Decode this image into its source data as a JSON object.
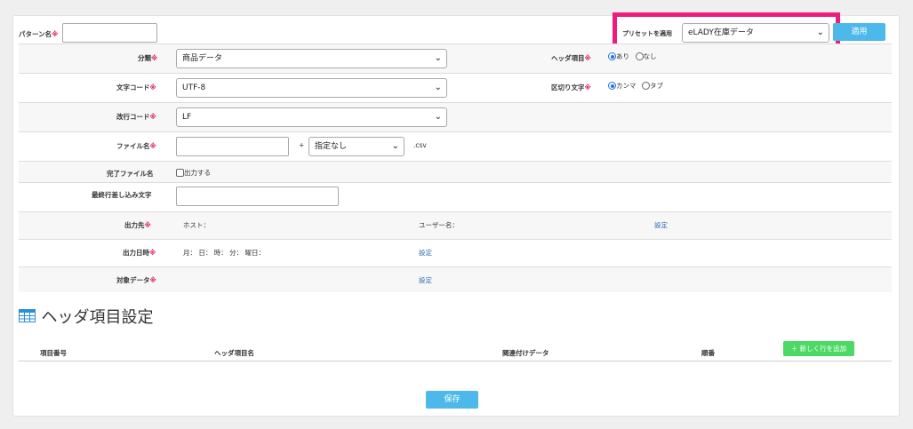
{
  "pattern": {
    "label": "パターン名",
    "req": "※",
    "value": ""
  },
  "preset": {
    "label": "プリセットを適用",
    "selected": "eLADY在庫データ",
    "apply_label": "適用"
  },
  "chev": "⌄",
  "fields": {
    "category": {
      "label": "分類",
      "req": "※",
      "selected": "商品データ"
    },
    "charset": {
      "label": "文字コード",
      "req": "※",
      "selected": "UTF-8"
    },
    "newline": {
      "label": "改行コード",
      "req": "※",
      "selected": "LF"
    },
    "filename": {
      "label": "ファイル名",
      "req": "※",
      "plus": "+",
      "suffix_selected": "指定なし",
      "ext": ".csv"
    },
    "complete_file": {
      "label": "完了ファイル名",
      "checkbox_label": "出力する"
    },
    "last_row": {
      "label": "最終行差し込み文字"
    },
    "output_dest": {
      "label": "出力先",
      "req": "※",
      "host": "ホスト：",
      "user": "ユーザー名：",
      "set": "設定"
    },
    "output_datetime": {
      "label": "出力日時",
      "req": "※",
      "schedule": "月： 日： 時： 分： 曜日：",
      "set": "設定"
    },
    "target_data": {
      "label": "対象データ",
      "req": "※",
      "set": "設定"
    }
  },
  "header_item": {
    "label": "ヘッダ項目",
    "req": "※",
    "options": [
      "あり",
      "なし"
    ],
    "selected": 0
  },
  "delimiter": {
    "label": "区切り文字",
    "req": "※",
    "options": [
      "カンマ",
      "タブ"
    ],
    "selected": 0
  },
  "section": {
    "title": "ヘッダ項目設定",
    "icon": "table-icon"
  },
  "table": {
    "columns": [
      "項目番号",
      "ヘッダ項目名",
      "関連付けデータ",
      "順番"
    ],
    "add_row": "＋ 新しく行を追加"
  },
  "save_label": "保存",
  "colors": {
    "accent": "#4db8ea",
    "highlight": "#ee1c7c",
    "add": "#4cd964",
    "required": "#e0245e"
  }
}
